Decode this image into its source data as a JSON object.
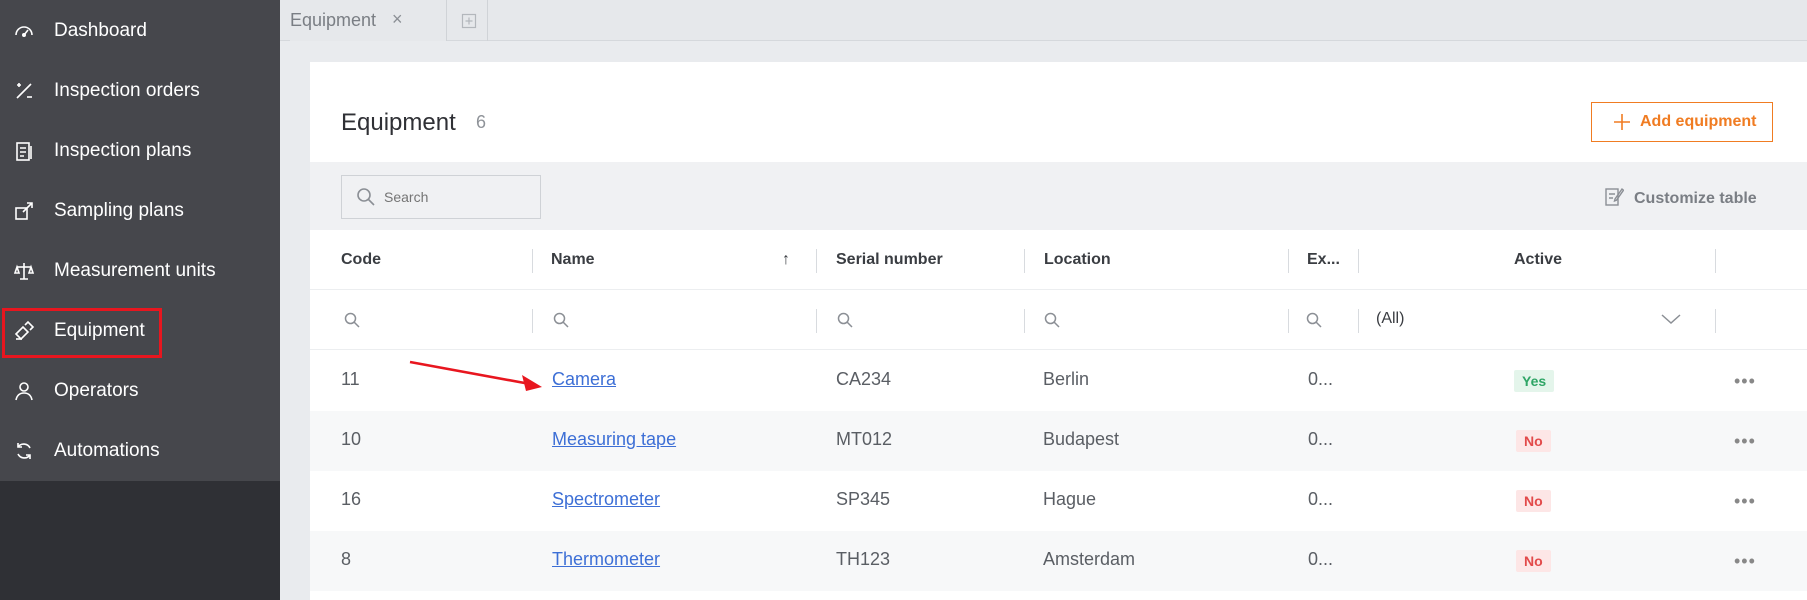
{
  "sidebar": {
    "items": [
      {
        "label": "Dashboard",
        "icon": "gauge-icon"
      },
      {
        "label": "Inspection orders",
        "icon": "tools-icon"
      },
      {
        "label": "Inspection plans",
        "icon": "clipboard-icon"
      },
      {
        "label": "Sampling plans",
        "icon": "sampling-icon"
      },
      {
        "label": "Measurement units",
        "icon": "scale-icon"
      },
      {
        "label": "Equipment",
        "icon": "equipment-icon"
      },
      {
        "label": "Operators",
        "icon": "user-icon"
      },
      {
        "label": "Automations",
        "icon": "sync-icon"
      }
    ],
    "active": "Equipment"
  },
  "tabs": [
    {
      "label": "Equipment",
      "close": "×"
    }
  ],
  "page": {
    "title": "Equipment",
    "count": "6",
    "add_button": "Add equipment",
    "customize": "Customize table"
  },
  "search": {
    "placeholder": "Search"
  },
  "table": {
    "columns": [
      "Code",
      "Name",
      "Serial number",
      "Location",
      "Ex...",
      "Active"
    ],
    "sort_icon": "↑",
    "filter_all": "(All)",
    "rows": [
      {
        "code": "11",
        "name": "Camera",
        "serial": "CA234",
        "location": "Berlin",
        "ex": "0...",
        "active": "Yes"
      },
      {
        "code": "10",
        "name": "Measuring tape",
        "serial": "MT012",
        "location": "Budapest",
        "ex": "0...",
        "active": "No"
      },
      {
        "code": "16",
        "name": "Spectrometer",
        "serial": "SP345",
        "location": "Hague",
        "ex": "0...",
        "active": "No"
      },
      {
        "code": "8",
        "name": "Thermometer",
        "serial": "TH123",
        "location": "Amsterdam",
        "ex": "0...",
        "active": "No"
      }
    ],
    "row_menu": "•••"
  },
  "colors": {
    "accent": "#f07c22",
    "sidebar": "#46474c",
    "highlight": "#e8161f",
    "link": "#3d6fd6",
    "yes": "#2fa566",
    "no": "#e24a4a"
  }
}
